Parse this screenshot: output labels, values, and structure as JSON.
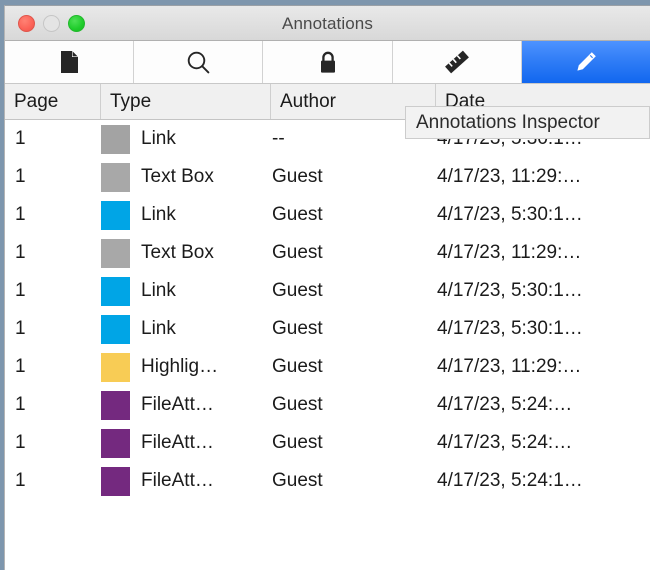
{
  "window": {
    "title": "Annotations",
    "controls": {
      "close_label": "close",
      "minimize_label": "minimize",
      "zoom_label": "zoom"
    }
  },
  "toolbar": {
    "items": [
      {
        "icon": "document-icon",
        "label": "Document",
        "selected": false
      },
      {
        "icon": "search-icon",
        "label": "Search",
        "selected": false
      },
      {
        "icon": "lock-icon",
        "label": "Encryption",
        "selected": false
      },
      {
        "icon": "ruler-icon",
        "label": "Measurements",
        "selected": false
      },
      {
        "icon": "pencil-icon",
        "label": "Annotations",
        "selected": true
      }
    ]
  },
  "tooltip": {
    "text": "Annotations Inspector",
    "visible": true
  },
  "table": {
    "columns": [
      "Page",
      "Type",
      "Author",
      "Date"
    ],
    "rows": [
      {
        "page": "1",
        "color": "#a3a3a3",
        "type": "Link",
        "author": "--",
        "date": "4/17/23, 5:30:1…"
      },
      {
        "page": "1",
        "color": "#a8a8a8",
        "type": "Text Box",
        "author": "Guest",
        "date": "4/17/23, 11:29:…"
      },
      {
        "page": "1",
        "color": "#00a5e6",
        "type": "Link",
        "author": "Guest",
        "date": "4/17/23, 5:30:1…"
      },
      {
        "page": "1",
        "color": "#a8a8a8",
        "type": "Text Box",
        "author": "Guest",
        "date": "4/17/23, 11:29:…"
      },
      {
        "page": "1",
        "color": "#00a5e6",
        "type": "Link",
        "author": "Guest",
        "date": "4/17/23, 5:30:1…"
      },
      {
        "page": "1",
        "color": "#00a5e6",
        "type": "Link",
        "author": "Guest",
        "date": "4/17/23, 5:30:1…"
      },
      {
        "page": "1",
        "color": "#f8cc55",
        "type": "Highlig…",
        "author": "Guest",
        "date": "4/17/23, 11:29:…"
      },
      {
        "page": "1",
        "color": "#74297f",
        "type": "FileAtt…",
        "author": "Guest",
        "date": "4/17/23, 5:24:…"
      },
      {
        "page": "1",
        "color": "#74297f",
        "type": "FileAtt…",
        "author": "Guest",
        "date": "4/17/23, 5:24:…"
      },
      {
        "page": "1",
        "color": "#74297f",
        "type": "FileAtt…",
        "author": "Guest",
        "date": "4/17/23, 5:24:1…"
      }
    ]
  },
  "colors": {
    "accent": "#2f7cf6",
    "titlebar_top": "#e9e9e9",
    "titlebar_bottom": "#d8d8d8",
    "header_bg": "#f0f0f0",
    "desktop": "#7e96ad"
  }
}
